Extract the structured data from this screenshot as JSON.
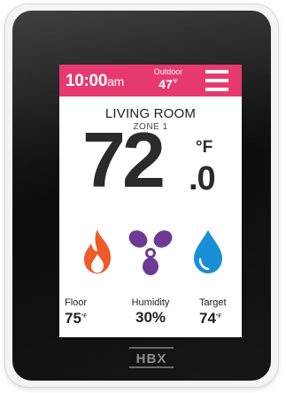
{
  "header": {
    "time": "10:00",
    "ampm": "am",
    "outdoor_label": "Outdoor",
    "outdoor_value": "47",
    "outdoor_unit": "°F"
  },
  "room": {
    "name": "LIVING ROOM",
    "zone": "ZONE 1"
  },
  "current_temp": {
    "integer": "72",
    "decimal": ".0",
    "unit": "°F"
  },
  "modes": [
    {
      "name": "heat",
      "icon": "flame-icon",
      "color": "#f05a28"
    },
    {
      "name": "fan",
      "icon": "fan-icon",
      "color": "#6e3a96"
    },
    {
      "name": "cool",
      "icon": "water-drop-icon",
      "color": "#1a8fd6"
    }
  ],
  "stats": {
    "floor": {
      "label": "Floor",
      "value": "75",
      "unit": "°F"
    },
    "humidity": {
      "label": "Humidity",
      "value": "30%"
    },
    "target": {
      "label": "Target",
      "value": "74",
      "unit": "°F"
    }
  },
  "brand": {
    "logo_text": "HBX"
  },
  "colors": {
    "header": "#e63a6e",
    "device": "#111111",
    "text": "#2b2b2b"
  }
}
